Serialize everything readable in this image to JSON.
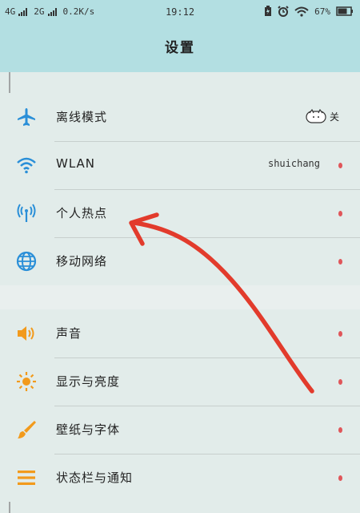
{
  "status": {
    "net1": "4G",
    "net2": "2G",
    "speed": "0.2K/s",
    "time": "19:12",
    "battery": "67%"
  },
  "header": {
    "title": "设置"
  },
  "settings": {
    "group1": [
      {
        "label": "离线模式",
        "icon": "airplane-icon",
        "value": "",
        "toggle": "关"
      },
      {
        "label": "WLAN",
        "icon": "wifi-icon",
        "value": "shuichang"
      },
      {
        "label": "个人热点",
        "icon": "hotspot-icon",
        "value": ""
      },
      {
        "label": "移动网络",
        "icon": "globe-icon",
        "value": ""
      }
    ],
    "group2": [
      {
        "label": "声音",
        "icon": "speaker-icon"
      },
      {
        "label": "显示与亮度",
        "icon": "sun-icon"
      },
      {
        "label": "壁纸与字体",
        "icon": "brush-icon"
      },
      {
        "label": "状态栏与通知",
        "icon": "menu-icon"
      }
    ]
  },
  "colors": {
    "accent": "#2a8fd8",
    "orange": "#f29a1c",
    "annotation": "#e23b2c",
    "header": "#b3dfe2"
  }
}
